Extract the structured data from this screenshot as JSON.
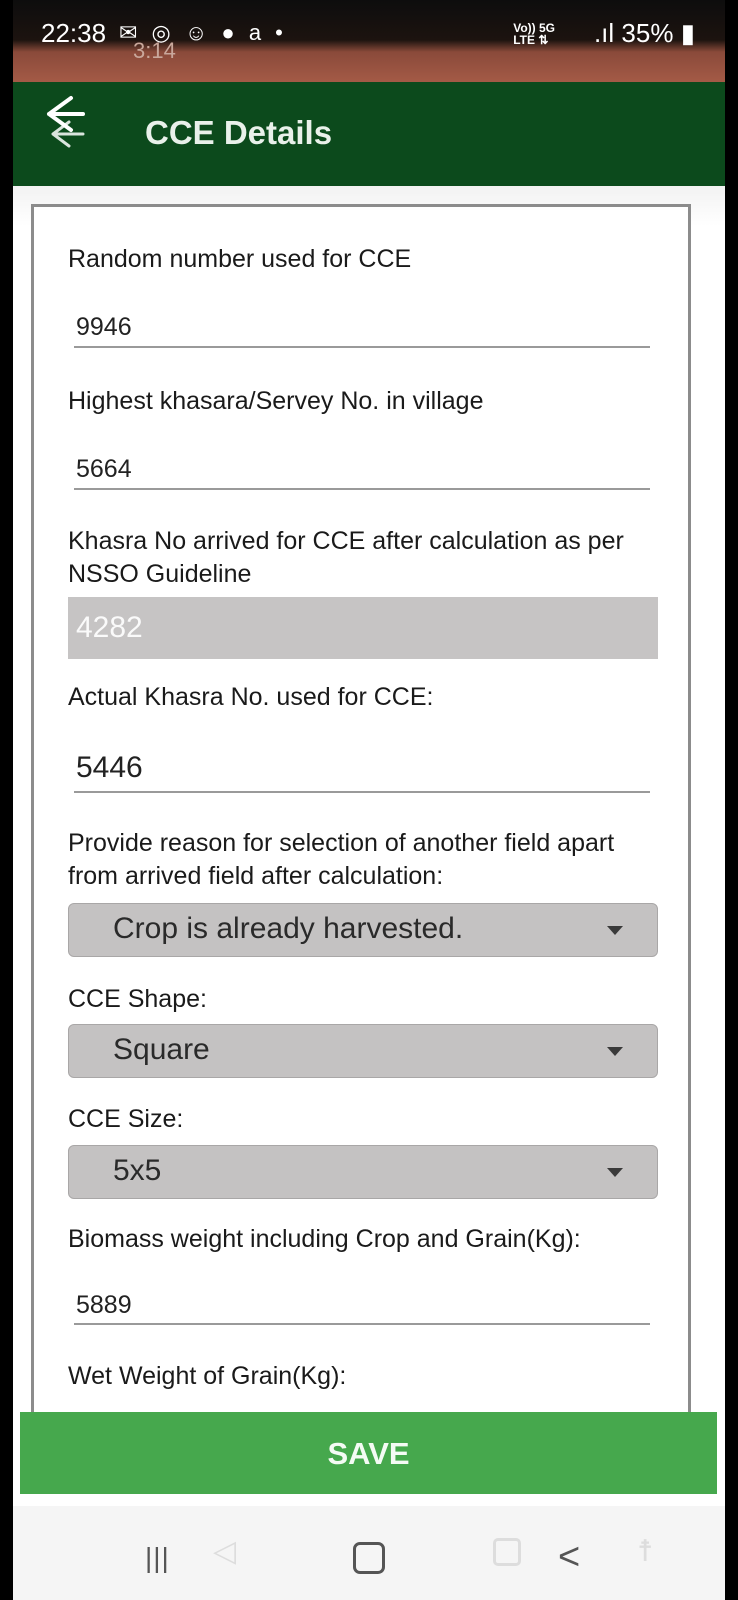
{
  "status_bar": {
    "time": "22:38",
    "left_icons": "✉ ◎ ☺ ● a •",
    "ghost_text": "3:14",
    "network": "Vo)) 5G\nLTE",
    "battery": "35%",
    "signal": ".ıl"
  },
  "app_bar": {
    "title": "CCE Details",
    "back_icon": "back-arrow-icon"
  },
  "form": {
    "random_number_label": "Random number used for CCE",
    "random_number_value": "9946",
    "highest_khasara_label": "Highest khasara/Servey No. in village",
    "highest_khasara_value": "5664",
    "khasra_arrived_label": "Khasra No arrived for CCE after calculation as per  NSSO Guideline",
    "khasra_arrived_value": "4282",
    "actual_khasra_label": "Actual Khasra No. used for CCE:",
    "actual_khasra_value": "5446",
    "reason_label": "Provide reason for selection of another field apart from arrived field after calculation:",
    "reason_value": "Crop is already harvested.",
    "shape_label": "CCE Shape:",
    "shape_value": "Square",
    "size_label": "CCE Size:",
    "size_value": "5x5",
    "biomass_label": "Biomass weight including Crop and Grain(Kg):",
    "biomass_value": "5889",
    "wet_weight_label": "Wet Weight of Grain(Kg):"
  },
  "save_button": "SAVE",
  "nav": {
    "recents": "|||",
    "back": "<"
  },
  "colors": {
    "app_bar": "#0c4a1c",
    "save": "#46a84d"
  }
}
